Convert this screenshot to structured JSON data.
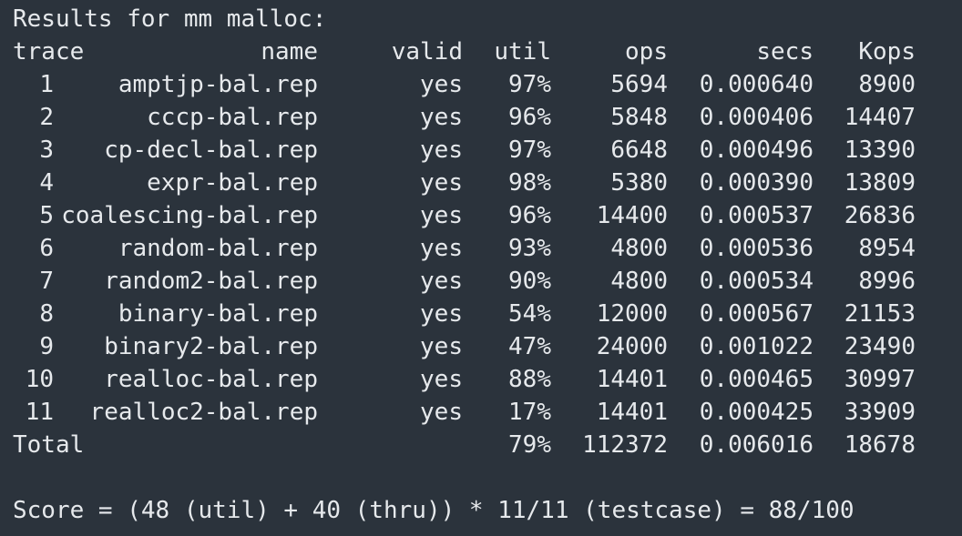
{
  "heading": "Results for mm malloc:",
  "columns": {
    "trace": "trace",
    "name": "name",
    "valid": "valid",
    "util": "util",
    "ops": "ops",
    "secs": "secs",
    "kops": "Kops"
  },
  "rows": [
    {
      "trace": "1",
      "name": "amptjp-bal.rep",
      "valid": "yes",
      "util": "97%",
      "ops": "5694",
      "secs": "0.000640",
      "kops": "8900"
    },
    {
      "trace": "2",
      "name": "cccp-bal.rep",
      "valid": "yes",
      "util": "96%",
      "ops": "5848",
      "secs": "0.000406",
      "kops": "14407"
    },
    {
      "trace": "3",
      "name": "cp-decl-bal.rep",
      "valid": "yes",
      "util": "97%",
      "ops": "6648",
      "secs": "0.000496",
      "kops": "13390"
    },
    {
      "trace": "4",
      "name": "expr-bal.rep",
      "valid": "yes",
      "util": "98%",
      "ops": "5380",
      "secs": "0.000390",
      "kops": "13809"
    },
    {
      "trace": "5",
      "name": "coalescing-bal.rep",
      "valid": "yes",
      "util": "96%",
      "ops": "14400",
      "secs": "0.000537",
      "kops": "26836"
    },
    {
      "trace": "6",
      "name": "random-bal.rep",
      "valid": "yes",
      "util": "93%",
      "ops": "4800",
      "secs": "0.000536",
      "kops": "8954"
    },
    {
      "trace": "7",
      "name": "random2-bal.rep",
      "valid": "yes",
      "util": "90%",
      "ops": "4800",
      "secs": "0.000534",
      "kops": "8996"
    },
    {
      "trace": "8",
      "name": "binary-bal.rep",
      "valid": "yes",
      "util": "54%",
      "ops": "12000",
      "secs": "0.000567",
      "kops": "21153"
    },
    {
      "trace": "9",
      "name": "binary2-bal.rep",
      "valid": "yes",
      "util": "47%",
      "ops": "24000",
      "secs": "0.001022",
      "kops": "23490"
    },
    {
      "trace": "10",
      "name": "realloc-bal.rep",
      "valid": "yes",
      "util": "88%",
      "ops": "14401",
      "secs": "0.000465",
      "kops": "30997"
    },
    {
      "trace": "11",
      "name": "realloc2-bal.rep",
      "valid": "yes",
      "util": "17%",
      "ops": "14401",
      "secs": "0.000425",
      "kops": "33909"
    }
  ],
  "total": {
    "label": "Total",
    "util": "79%",
    "ops": "112372",
    "secs": "0.006016",
    "kops": "18678"
  },
  "score_line": "Score = (48 (util) + 40 (thru)) * 11/11 (testcase) = 88/100",
  "colors": {
    "background": "#2b333c",
    "text": "#e6e9ec",
    "prompt": "#7ec87a"
  }
}
